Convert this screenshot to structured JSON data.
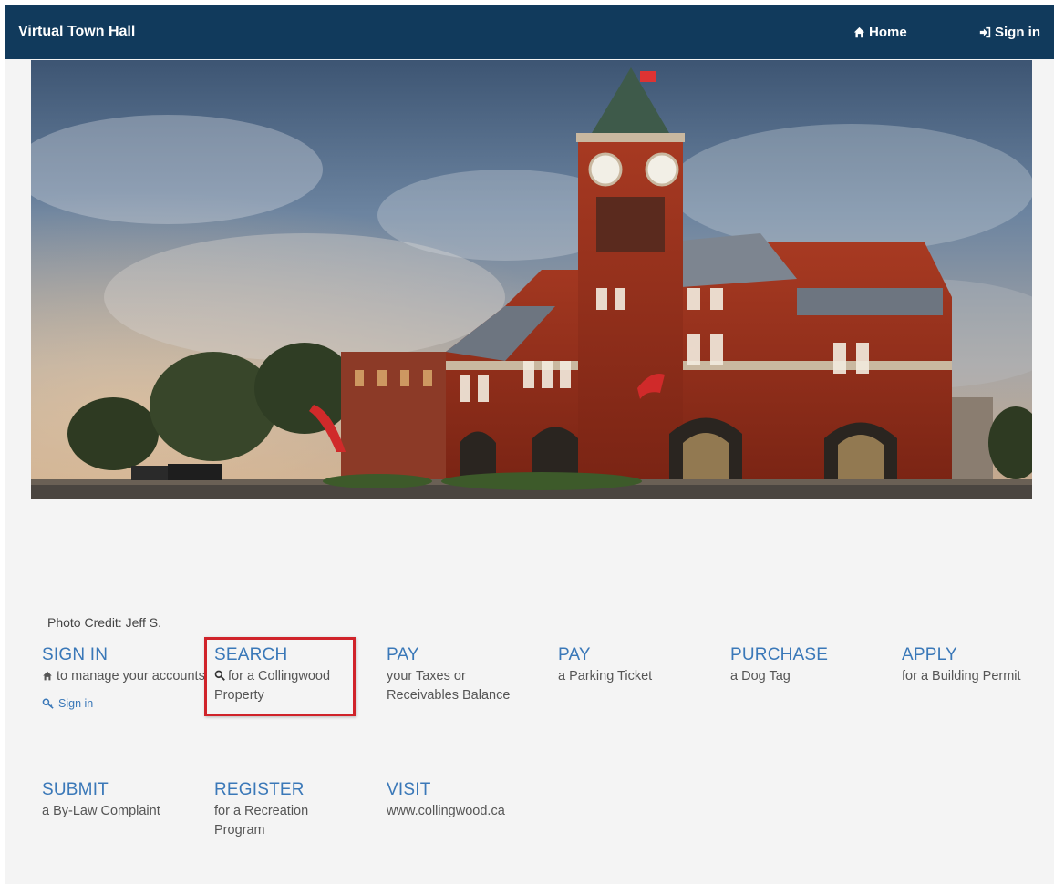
{
  "navbar": {
    "brand": "Virtual Town Hall",
    "home_label": "Home",
    "signin_label": "Sign in"
  },
  "photo_credit": "Photo Credit: Jeff S.",
  "tiles": [
    {
      "title": "SIGN IN",
      "desc": "to manage your accounts",
      "link": "Sign in"
    },
    {
      "title": "SEARCH",
      "desc": "for a Collingwood Property"
    },
    {
      "title": "PAY",
      "desc": "your Taxes or Receivables Balance"
    },
    {
      "title": "PAY",
      "desc": "a Parking Ticket"
    },
    {
      "title": "PURCHASE",
      "desc": "a Dog Tag"
    },
    {
      "title": "APPLY",
      "desc": "for a Building Permit"
    },
    {
      "title": "SUBMIT",
      "desc": "a By-Law Complaint"
    },
    {
      "title": "REGISTER",
      "desc": "for a Recreation Program"
    },
    {
      "title": "VISIT",
      "desc": "www.collingwood.ca"
    }
  ],
  "colors": {
    "navbar": "#113a5c",
    "link": "#3a78b8",
    "highlight": "#d0232a"
  },
  "icons": {
    "home": "home-icon",
    "signin": "sign-in-icon",
    "search": "search-icon",
    "key": "key-icon"
  }
}
